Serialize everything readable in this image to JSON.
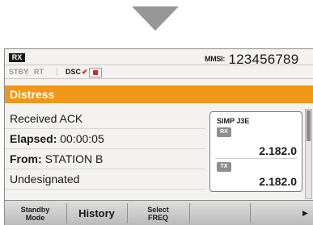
{
  "header": {
    "rx_badge": "RX",
    "mmsi_label": "MMSI",
    "mmsi_number": "123456789"
  },
  "status": {
    "stby": "STBY",
    "rt": "RT",
    "dsc": "DSC",
    "dsc_mark": "✔",
    "record_color": "#e02525"
  },
  "title": {
    "text": "Distress",
    "color": "#ef9719"
  },
  "info": {
    "line1": "Received ACK",
    "elapsed_label": "Elapsed:",
    "elapsed_value": "00:00:05",
    "from_label": "From:",
    "from_value": "STATION B",
    "line4": "Undesignated"
  },
  "freq": {
    "mode": "SIMP J3E",
    "rx_label": "RX",
    "rx_value": "2.182.0",
    "tx_label": "TX",
    "tx_value": "2.182.0"
  },
  "softkeys": {
    "standby_line1": "Standby",
    "standby_line2": "Mode",
    "history": "History",
    "select_line1": "Select",
    "select_line2": "FREQ",
    "next_icon": "chevron-right-icon"
  }
}
